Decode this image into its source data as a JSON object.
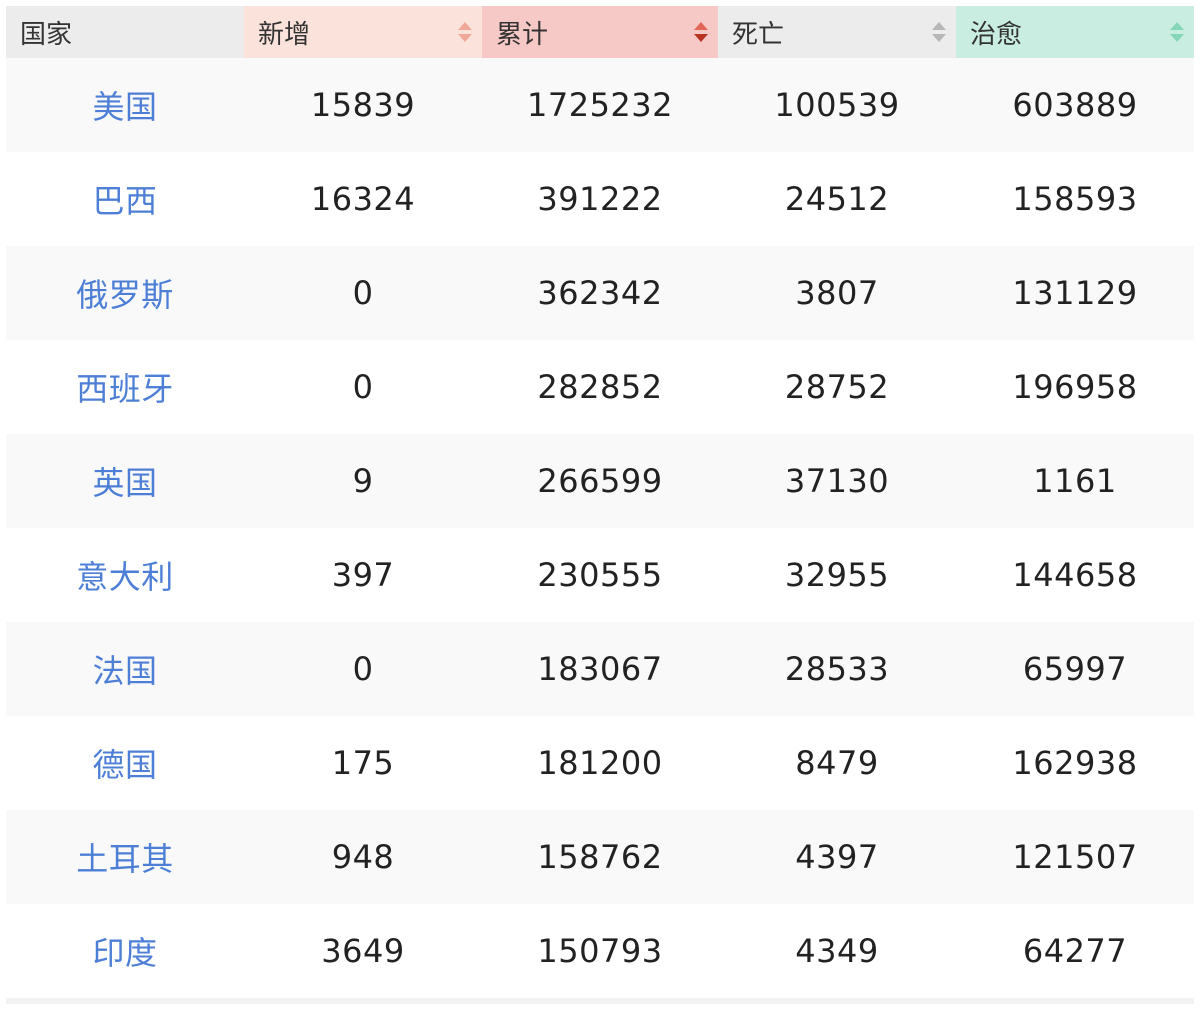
{
  "header": {
    "columns": [
      {
        "key": "country",
        "label": "国家",
        "bg": "#ececec",
        "sortable": false
      },
      {
        "key": "new",
        "label": "新增",
        "bg": "#fbe3dc",
        "sortable": true,
        "sort_up": "#f0a898",
        "sort_down": "#f0a898"
      },
      {
        "key": "total",
        "label": "累计",
        "bg": "#f7c9c6",
        "sortable": true,
        "sort_up": "#e06656",
        "sort_down": "#b73322"
      },
      {
        "key": "deaths",
        "label": "死亡",
        "bg": "#ececec",
        "sortable": true,
        "sort_up": "#b7b7b7",
        "sort_down": "#b7b7b7"
      },
      {
        "key": "recovered",
        "label": "治愈",
        "bg": "#c9ede0",
        "sortable": true,
        "sort_up": "#86d6b8",
        "sort_down": "#86d6b8"
      }
    ]
  },
  "rows": [
    {
      "country": "美国",
      "new": "15839",
      "total": "1725232",
      "deaths": "100539",
      "recovered": "603889"
    },
    {
      "country": "巴西",
      "new": "16324",
      "total": "391222",
      "deaths": "24512",
      "recovered": "158593"
    },
    {
      "country": "俄罗斯",
      "new": "0",
      "total": "362342",
      "deaths": "3807",
      "recovered": "131129"
    },
    {
      "country": "西班牙",
      "new": "0",
      "total": "282852",
      "deaths": "28752",
      "recovered": "196958"
    },
    {
      "country": "英国",
      "new": "9",
      "total": "266599",
      "deaths": "37130",
      "recovered": "1161"
    },
    {
      "country": "意大利",
      "new": "397",
      "total": "230555",
      "deaths": "32955",
      "recovered": "144658"
    },
    {
      "country": "法国",
      "new": "0",
      "total": "183067",
      "deaths": "28533",
      "recovered": "65997"
    },
    {
      "country": "德国",
      "new": "175",
      "total": "181200",
      "deaths": "8479",
      "recovered": "162938"
    },
    {
      "country": "土耳其",
      "new": "948",
      "total": "158762",
      "deaths": "4397",
      "recovered": "121507"
    },
    {
      "country": "印度",
      "new": "3649",
      "total": "150793",
      "deaths": "4349",
      "recovered": "64277"
    }
  ],
  "colors": {
    "country_link": "#4d7fd6",
    "text": "#222222"
  }
}
